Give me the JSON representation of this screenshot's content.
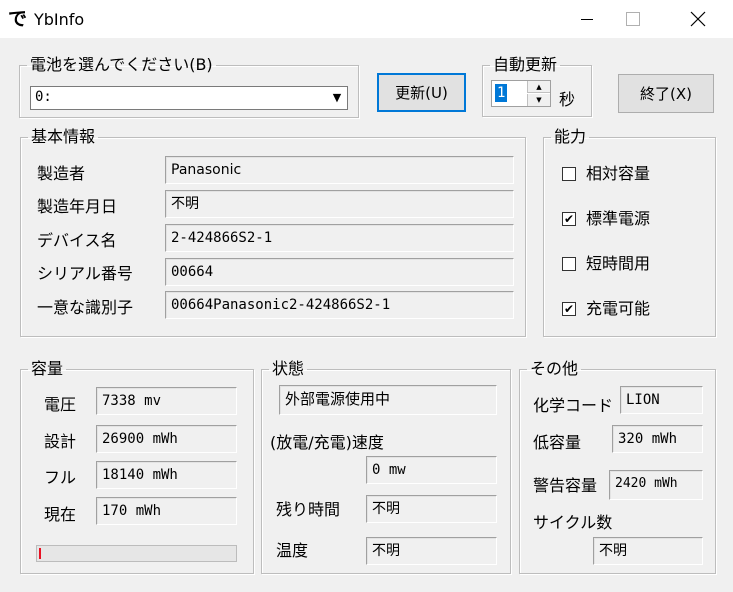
{
  "window": {
    "title": "YbInfo",
    "icon_glyph": "で"
  },
  "controls": {
    "minimize": "─",
    "maximize": "□",
    "close": "✕"
  },
  "battery_select": {
    "legend": "電池を選んでください(B)",
    "selected": "0:",
    "arrow": "▼"
  },
  "refresh_button": "更新(U)",
  "auto_update": {
    "legend": "自動更新",
    "value": "1",
    "unit": "秒",
    "up": "▲",
    "down": "▼"
  },
  "exit_button": "終了(X)",
  "basic_info": {
    "legend": "基本情報",
    "rows": [
      {
        "label": "製造者",
        "value": "Panasonic"
      },
      {
        "label": "製造年月日",
        "value": "不明"
      },
      {
        "label": "デバイス名",
        "value": "2-424866S2-1"
      },
      {
        "label": "シリアル番号",
        "value": "00664"
      },
      {
        "label": "一意な識別子",
        "value": "00664Panasonic2-424866S2-1"
      }
    ]
  },
  "capability": {
    "legend": "能力",
    "items": [
      {
        "label": "相対容量",
        "checked": false,
        "mark": ""
      },
      {
        "label": "標準電源",
        "checked": true,
        "mark": "✔"
      },
      {
        "label": "短時間用",
        "checked": false,
        "mark": ""
      },
      {
        "label": "充電可能",
        "checked": true,
        "mark": "✔"
      }
    ]
  },
  "capacity": {
    "legend": "容量",
    "rows": [
      {
        "label": "電圧",
        "value": "7338 mv"
      },
      {
        "label": "設計",
        "value": "26900 mWh"
      },
      {
        "label": "フル",
        "value": "18140 mWh"
      },
      {
        "label": "現在",
        "value": "170 mWh"
      }
    ],
    "charge_fraction": 0.0094,
    "bar_color": "#e81123"
  },
  "state": {
    "legend": "状態",
    "status": "外部電源使用中",
    "rate_label": "(放電/充電)速度",
    "rate_value": "0 mw",
    "remaining_label": "残り時間",
    "remaining_value": "不明",
    "temp_label": "温度",
    "temp_value": "不明"
  },
  "other": {
    "legend": "その他",
    "chemistry_label": "化学コード",
    "chemistry_value": "LION",
    "low_label": "低容量",
    "low_value": "320 mWh",
    "warn_label": "警告容量",
    "warn_value": "2420 mWh",
    "cycle_label": "サイクル数",
    "cycle_value": "不明"
  },
  "colors": {
    "accent": "#0078d7",
    "window_bg": "#f0f0f0",
    "titlebar_bg": "#ffffff"
  }
}
